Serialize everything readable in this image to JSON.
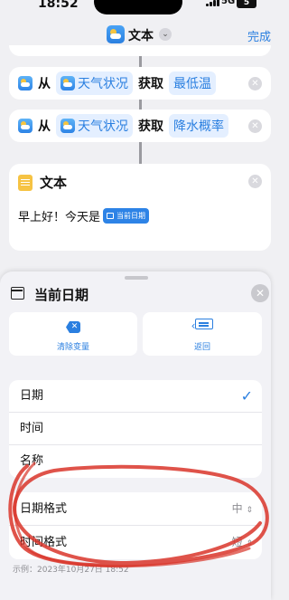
{
  "status": {
    "time": "18:52",
    "network": "5G",
    "battery": "5"
  },
  "nav": {
    "title": "文本",
    "done": "完成"
  },
  "actions": [
    {
      "from": "从",
      "source": "天气状况",
      "get": "获取",
      "detail": "最低温"
    },
    {
      "from": "从",
      "source": "天气状况",
      "get": "获取",
      "detail": "降水概率"
    }
  ],
  "text_action": {
    "title": "文本",
    "body": "早上好！今天是",
    "variable": "当前日期"
  },
  "sheet": {
    "title": "当前日期",
    "clear_label": "清除变量",
    "back_label": "返回",
    "options": [
      {
        "label": "日期",
        "selected": true
      },
      {
        "label": "时间",
        "selected": false
      },
      {
        "label": "名称",
        "selected": false
      }
    ],
    "format_rows": [
      {
        "label": "日期格式",
        "value": "中"
      },
      {
        "label": "时间格式",
        "value": "短"
      }
    ],
    "bottom_note": "示例：2023年10月27日 18:52"
  },
  "annotation_color": "#d9352a"
}
